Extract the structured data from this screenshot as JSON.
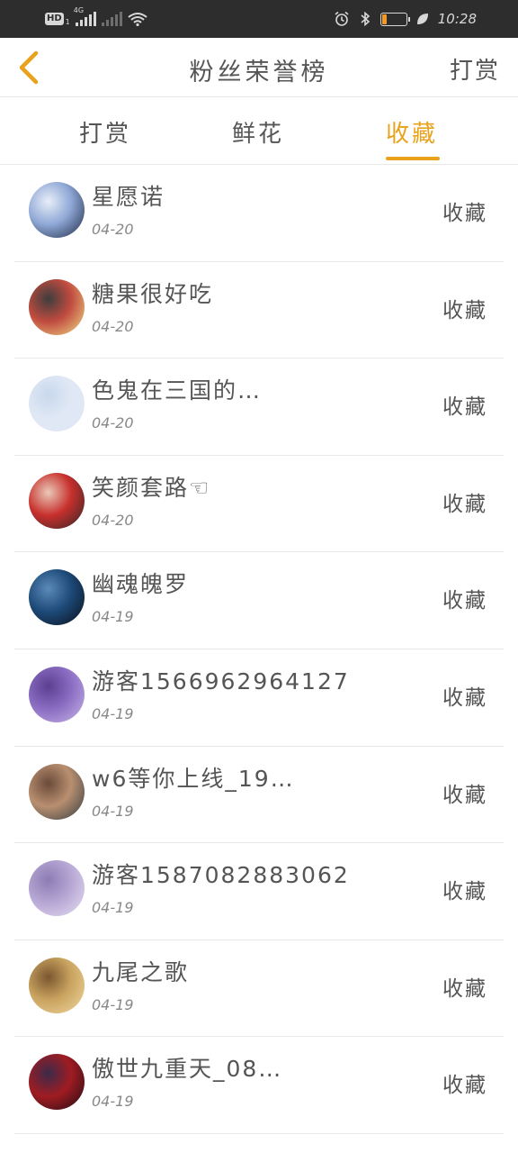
{
  "status_bar": {
    "hd_label": "HD",
    "hd_sub": "1",
    "network_label": "4G",
    "battery_level": "19",
    "time": "10:28"
  },
  "header": {
    "title": "粉丝荣誉榜",
    "action_label": "打赏"
  },
  "tabs": [
    {
      "label": "打赏",
      "active": false
    },
    {
      "label": "鲜花",
      "active": false
    },
    {
      "label": "收藏",
      "active": true
    }
  ],
  "accent_color": "#e9a21b",
  "list": [
    {
      "name": "星愿诺",
      "date": "04-20",
      "action": "收藏",
      "avatar_colors": [
        "#1b2640",
        "#8fa8d6",
        "#e8eef8"
      ]
    },
    {
      "name": "糖果很好吃",
      "date": "04-20",
      "action": "收藏",
      "avatar_colors": [
        "#f3e28a",
        "#c04b3f",
        "#3d3d3d"
      ]
    },
    {
      "name": "色鬼在三国的…",
      "date": "04-20",
      "action": "收藏",
      "avatar_colors": [
        "#dfe8f4",
        "#dfe8f4",
        "#c9d8ee"
      ]
    },
    {
      "name": "笑颜套路☜",
      "date": "04-20",
      "action": "收藏",
      "avatar_colors": [
        "#2a2626",
        "#c8302d",
        "#e9c9b8"
      ]
    },
    {
      "name": "幽魂魄罗",
      "date": "04-19",
      "action": "收藏",
      "avatar_colors": [
        "#0a0d18",
        "#1d4a78",
        "#5c8ab8"
      ]
    },
    {
      "name": "游客1566962964127",
      "date": "04-19",
      "action": "收藏",
      "avatar_colors": [
        "#c9b7e8",
        "#8a6cc2",
        "#5b3f8f"
      ]
    },
    {
      "name": "w6等你上线_19…",
      "date": "04-19",
      "action": "收藏",
      "avatar_colors": [
        "#2f3a3f",
        "#b98f70",
        "#6a4a3a"
      ]
    },
    {
      "name": "游客1587082883062",
      "date": "04-19",
      "action": "收藏",
      "avatar_colors": [
        "#e7e0f2",
        "#b6a6d4",
        "#8b7cb3"
      ]
    },
    {
      "name": "九尾之歌",
      "date": "04-19",
      "action": "收藏",
      "avatar_colors": [
        "#f2d9a2",
        "#c9a35f",
        "#7a5630"
      ]
    },
    {
      "name": "傲世九重天_08…",
      "date": "04-19",
      "action": "收藏",
      "avatar_colors": [
        "#1c0c14",
        "#a01c22",
        "#3b2a4a"
      ]
    }
  ]
}
